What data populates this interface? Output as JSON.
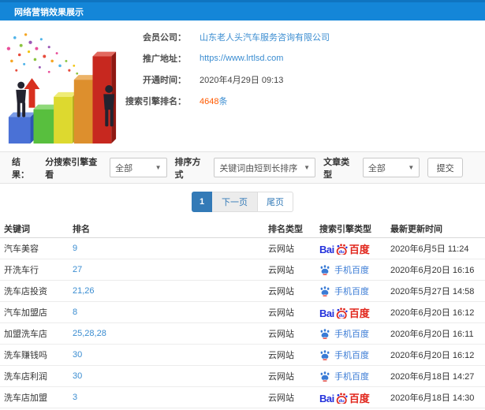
{
  "colors": {
    "header_bg": "#1486d8",
    "header_bg_dark": "#0f74c0",
    "link": "#3b8dd1",
    "accent_orange": "#ff5a00",
    "page_active": "#337ab7",
    "baidu_blue": "#2432dc",
    "baidu_red": "#e1251b",
    "mobile_blue": "#3a7bd5"
  },
  "header": {
    "title": "网络营销效果展示"
  },
  "info": {
    "rows": [
      {
        "label": "会员公司：",
        "value": "山东老人头汽车服务咨询有限公司",
        "type": "link"
      },
      {
        "label": "推广地址：",
        "value": "https://www.lrtlsd.com",
        "type": "link"
      },
      {
        "label": "开通时间：",
        "value": "2020年4月29日 09:13",
        "type": "text"
      },
      {
        "label": "搜索引擎排名：",
        "value": "4648",
        "suffix": "条",
        "type": "highlight"
      }
    ]
  },
  "filter": {
    "result_label": "结果：",
    "engine_view_label": "分搜索引擎查看",
    "engine_view_value": "全部",
    "sort_label": "排序方式",
    "sort_value": "关键词由短到长排序",
    "article_type_label": "文章类型",
    "article_type_value": "全部",
    "submit_label": "提交"
  },
  "pagination": {
    "current": "1",
    "next": "下一页",
    "last": "尾页"
  },
  "table": {
    "headers": {
      "keyword": "关键词",
      "rank": "排名",
      "rank_type": "排名类型",
      "engine_type": "搜索引擎类型",
      "update_time": "最新更新时间"
    },
    "engine_labels": {
      "baidu_prefix": "Bai",
      "baidu_du": "du",
      "baidu_suffix": "百度",
      "mobile": "手机百度"
    },
    "rows": [
      {
        "keyword": "汽车美容",
        "rank": "9",
        "rank_type": "云网站",
        "engine": "baidu",
        "time": "2020年6月5日 11:24"
      },
      {
        "keyword": "开洗车行",
        "rank": "27",
        "rank_type": "云网站",
        "engine": "mobile",
        "time": "2020年6月20日 16:16"
      },
      {
        "keyword": "洗车店投资",
        "rank": "21,26",
        "rank_type": "云网站",
        "engine": "mobile",
        "time": "2020年5月27日 14:58"
      },
      {
        "keyword": "汽车加盟店",
        "rank": "8",
        "rank_type": "云网站",
        "engine": "baidu",
        "time": "2020年6月20日 16:12"
      },
      {
        "keyword": "加盟洗车店",
        "rank": "25,28,28",
        "rank_type": "云网站",
        "engine": "mobile",
        "time": "2020年6月20日 16:11"
      },
      {
        "keyword": "洗车赚钱吗",
        "rank": "30",
        "rank_type": "云网站",
        "engine": "mobile",
        "time": "2020年6月20日 16:12"
      },
      {
        "keyword": "洗车店利润",
        "rank": "30",
        "rank_type": "云网站",
        "engine": "mobile",
        "time": "2020年6月18日 14:27"
      },
      {
        "keyword": "洗车店加盟",
        "rank": "3",
        "rank_type": "云网站",
        "engine": "baidu",
        "time": "2020年6月18日 14:30"
      }
    ]
  }
}
